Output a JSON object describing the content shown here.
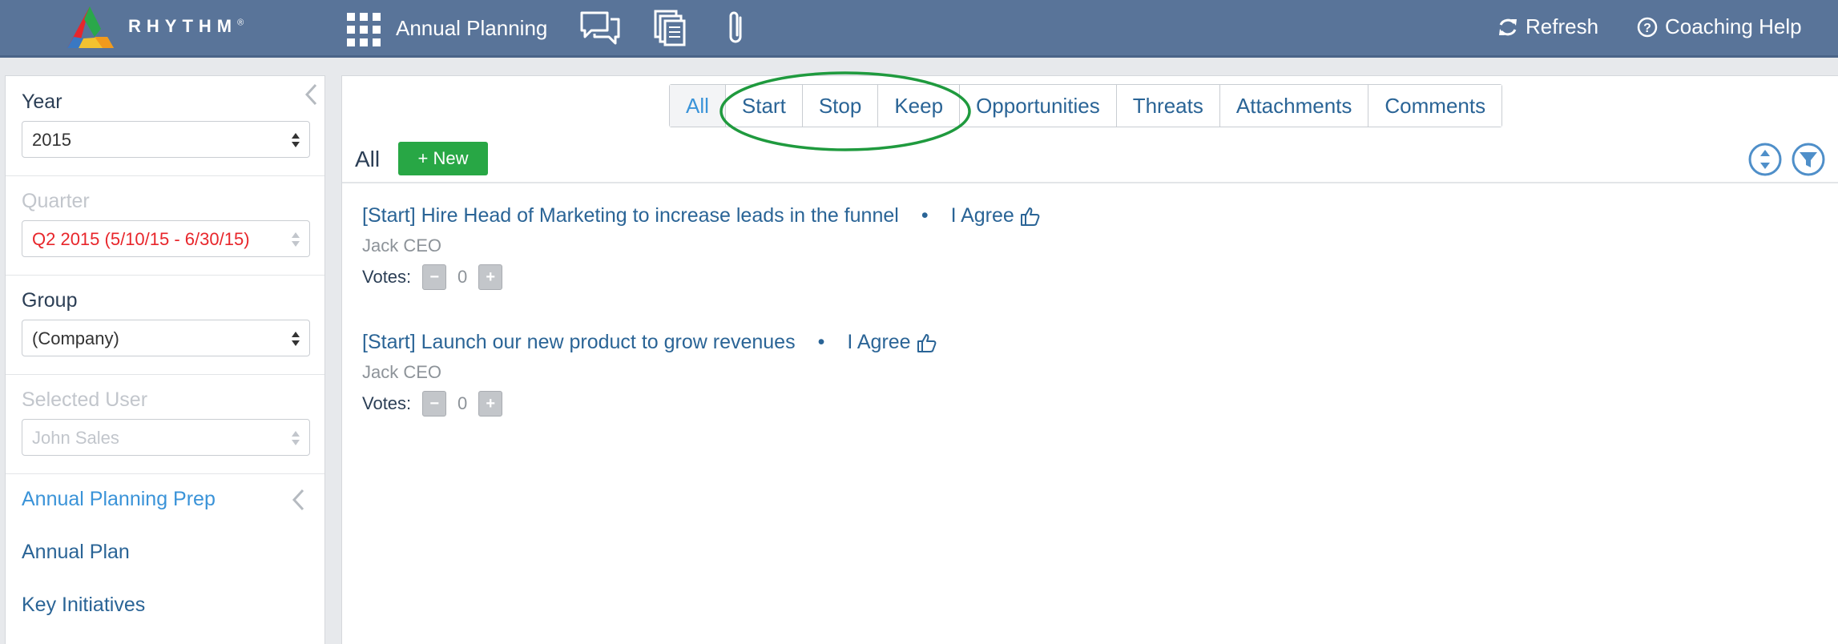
{
  "topbar": {
    "brand": "RHYTHM",
    "brand_mark": "®",
    "app_title": "Annual Planning",
    "refresh_label": "Refresh",
    "help_label": "Coaching Help",
    "icons": [
      "apps-grid-icon",
      "chat-icon",
      "documents-icon",
      "paperclip-icon",
      "refresh-icon",
      "help-circle-icon"
    ]
  },
  "sidebar": {
    "year": {
      "label": "Year",
      "value": "2015"
    },
    "quarter": {
      "label": "Quarter",
      "value": "Q2 2015 (5/10/15 - 6/30/15)"
    },
    "group": {
      "label": "Group",
      "value": "(Company)"
    },
    "selected_user": {
      "label": "Selected User",
      "value": "John Sales"
    },
    "nav": [
      {
        "label": "Annual Planning Prep",
        "active": true
      },
      {
        "label": "Annual Plan",
        "active": false
      },
      {
        "label": "Key Initiatives",
        "active": false
      }
    ]
  },
  "main": {
    "tabs": [
      "All",
      "Start",
      "Stop",
      "Keep",
      "Opportunities",
      "Threats",
      "Attachments",
      "Comments"
    ],
    "section_title": "All",
    "new_button": "+ New",
    "items": [
      {
        "title": "[Start] Hire Head of Marketing to increase leads in the funnel",
        "bullet": "•",
        "agree": "I Agree",
        "author": "Jack CEO",
        "votes_label": "Votes:",
        "votes": "0"
      },
      {
        "title": "[Start] Launch our new product to grow revenues",
        "bullet": "•",
        "agree": "I Agree",
        "author": "Jack CEO",
        "votes_label": "Votes:",
        "votes": "0"
      }
    ],
    "vote_minus": "−",
    "vote_plus": "+"
  },
  "colors": {
    "topbar": "#597499",
    "link": "#2a6496",
    "active_link": "#3a93d8",
    "new_button": "#28a745",
    "highlight_ring": "#1f9a3e",
    "quarter_text": "#e8262b"
  }
}
